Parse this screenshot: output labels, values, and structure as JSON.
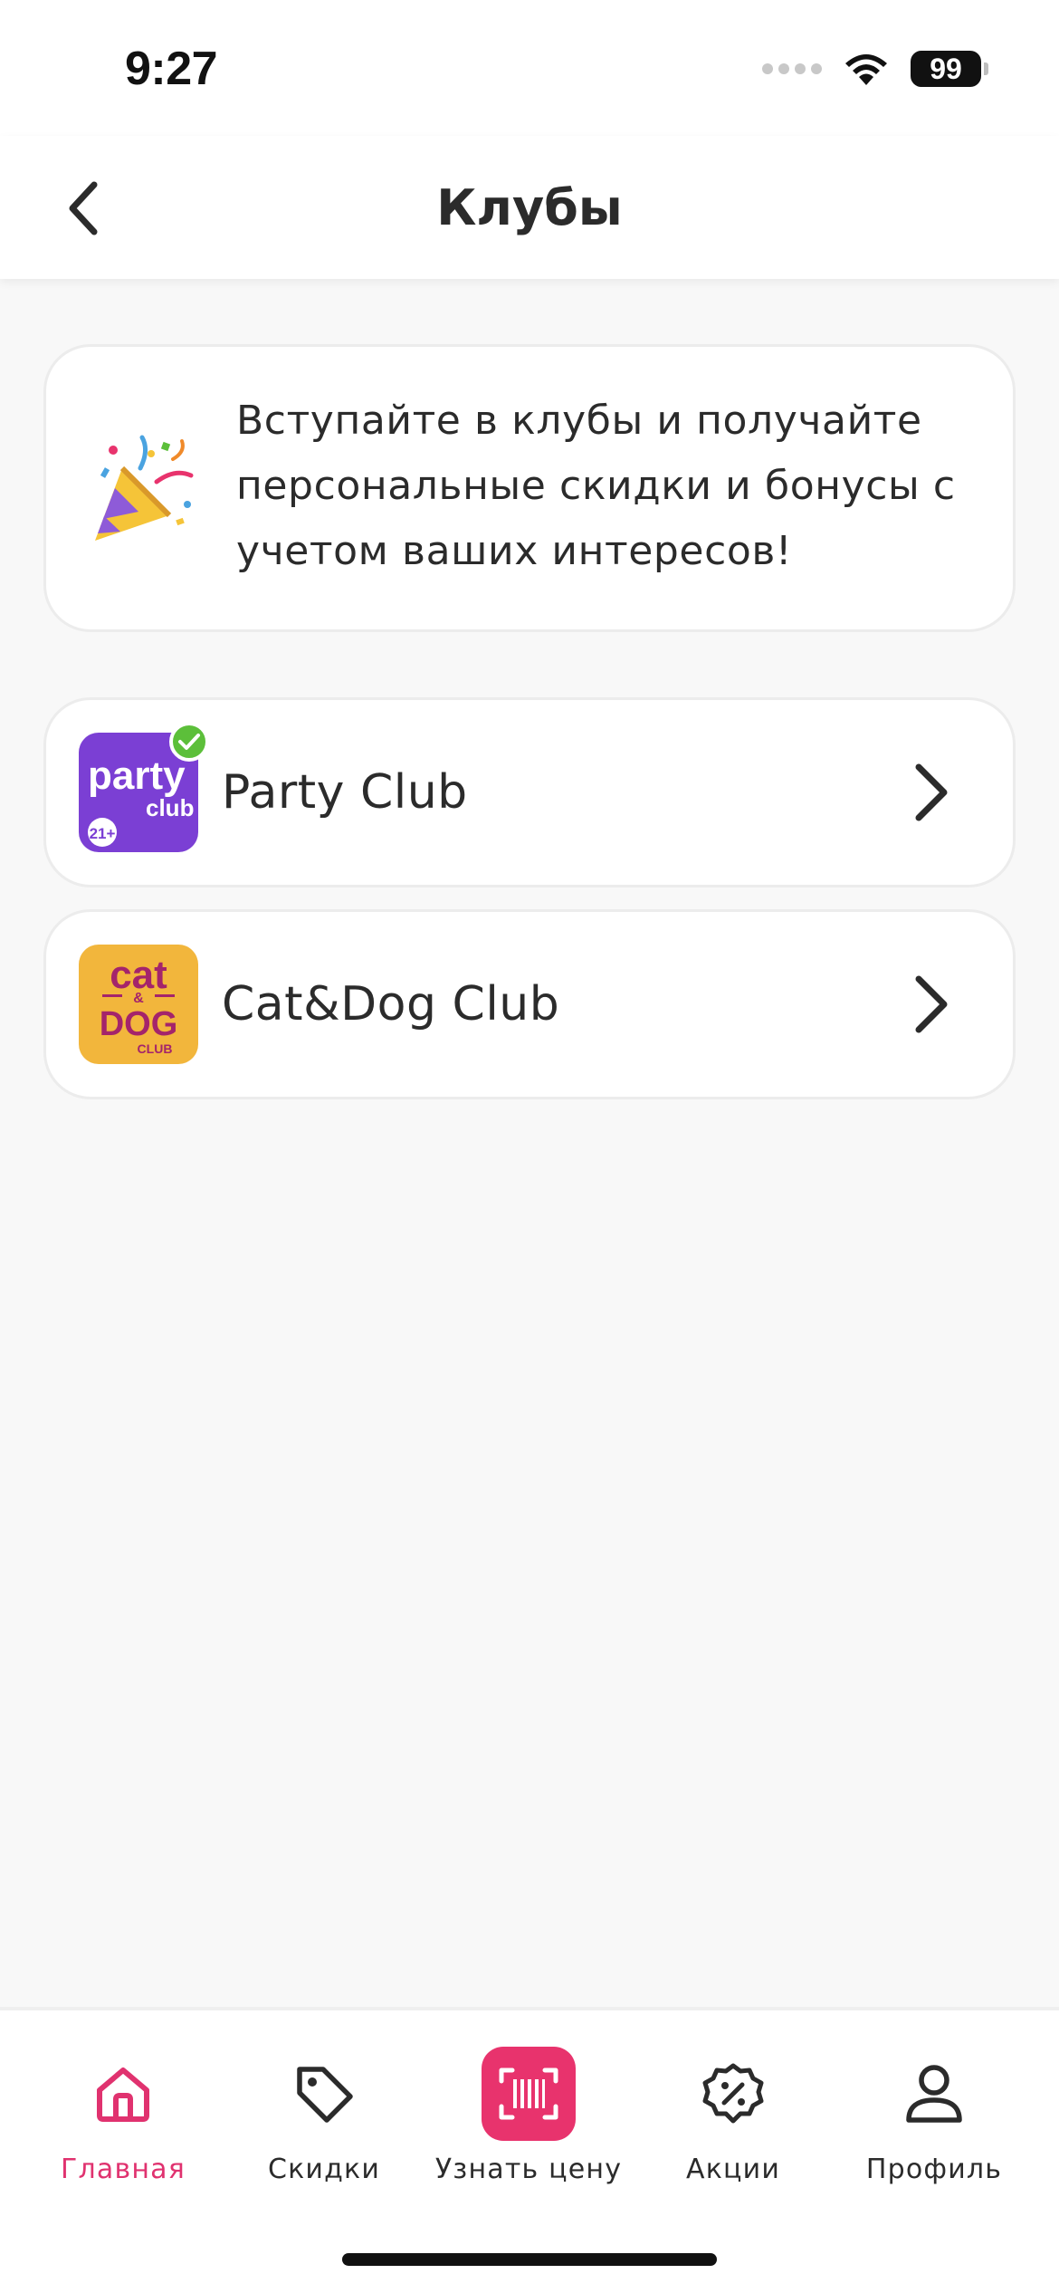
{
  "status_bar": {
    "time": "9:27",
    "battery": "99"
  },
  "header": {
    "title": "Клубы"
  },
  "info_card": {
    "icon": "party-popper-icon",
    "text": "Вступайте в клубы и получайте персональные скидки и бонусы с учетом ваших интересов!"
  },
  "clubs": [
    {
      "name": "Party Club",
      "logo": {
        "line1": "party",
        "line2": "club",
        "age": "21+",
        "bg": "#7b3fd4"
      },
      "joined": true
    },
    {
      "name": "Cat&Dog Club",
      "logo": {
        "line1": "cat",
        "amp": "&",
        "line2": "DOG",
        "line3": "CLUB",
        "bg": "#f2b63c",
        "fg": "#a4246b"
      },
      "joined": false
    }
  ],
  "tab_bar": {
    "active": "home",
    "tabs": [
      {
        "id": "home",
        "label": "Главная",
        "icon": "home-icon"
      },
      {
        "id": "discounts",
        "label": "Скидки",
        "icon": "tag-icon"
      },
      {
        "id": "price",
        "label": "Узнать цену",
        "icon": "barcode-scan-icon"
      },
      {
        "id": "promos",
        "label": "Акции",
        "icon": "percent-badge-icon"
      },
      {
        "id": "profile",
        "label": "Профиль",
        "icon": "user-icon"
      }
    ]
  },
  "colors": {
    "accent": "#e8336d",
    "active_tab": "#e0326f",
    "check": "#5cbf3a"
  }
}
